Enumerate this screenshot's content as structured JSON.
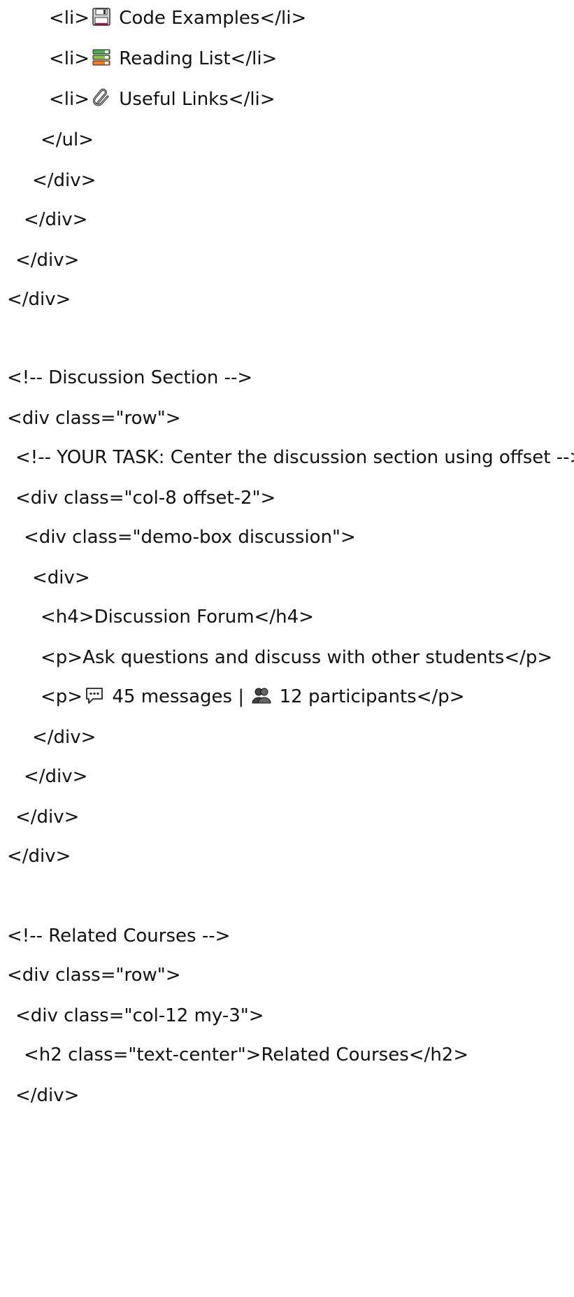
{
  "lines": [
    {
      "pre": "<li>",
      "icon": "floppy-disk-icon",
      "post": " Code Examples</li>"
    },
    {
      "pre": "<li>",
      "icon": "books-icon",
      "post": " Reading List</li>"
    },
    {
      "pre": "<li>",
      "icon": "paperclip-icon",
      "post": " Useful Links</li>"
    },
    {
      "text": "</ul>"
    },
    {
      "text": "</div>"
    },
    {
      "text": "</div>"
    },
    {
      "text": "</div>"
    },
    {
      "text": "</div>"
    },
    {
      "text": "<!-- Discussion Section -->"
    },
    {
      "text": "<div class=\"row\">"
    },
    {
      "text": "<!-- YOUR TASK: Center the discussion section using offset -->"
    },
    {
      "text": "<div class=\"col-8 offset-2\">"
    },
    {
      "text": "<div class=\"demo-box discussion\">"
    },
    {
      "text": "<div>"
    },
    {
      "text": "<h4>Discussion Forum</h4>"
    },
    {
      "text": "<p>Ask questions and discuss with other students</p>"
    },
    {
      "pre": "<p>",
      "icon": "speech-bubble-icon",
      "mid": " 45 messages | ",
      "icon2": "people-icon",
      "post": " 12 participants</p>"
    },
    {
      "text": "</div>"
    },
    {
      "text": "</div>"
    },
    {
      "text": "</div>"
    },
    {
      "text": "</div>"
    },
    {
      "text": "<!-- Related Courses -->"
    },
    {
      "text": "<div class=\"row\">"
    },
    {
      "text": "<div class=\"col-12 my-3\">"
    },
    {
      "text": "<h2 class=\"text-center\">Related Courses</h2>"
    },
    {
      "text": "</div>"
    }
  ]
}
